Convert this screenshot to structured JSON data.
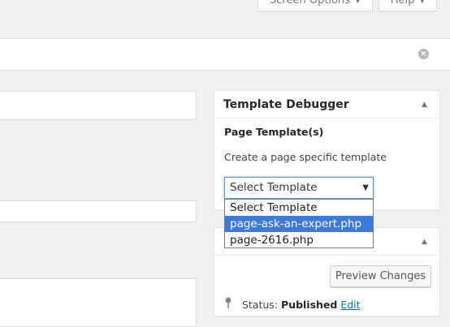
{
  "header": {
    "screen_options_label": "Screen Options",
    "help_label": "Help"
  },
  "sidebar_widget": {
    "title": "Template Debugger",
    "section_label": "Page Template(s)",
    "description": "Create a page specific template",
    "select": {
      "value": "Select Template",
      "options": [
        "Select Template",
        "page-ask-an-expert.php",
        "page-2616.php"
      ],
      "highlighted_index": 1
    }
  },
  "publish_box": {
    "preview_label": "Preview Changes",
    "status_label": "Status:",
    "status_value": "Published",
    "edit_label": "Edit"
  }
}
